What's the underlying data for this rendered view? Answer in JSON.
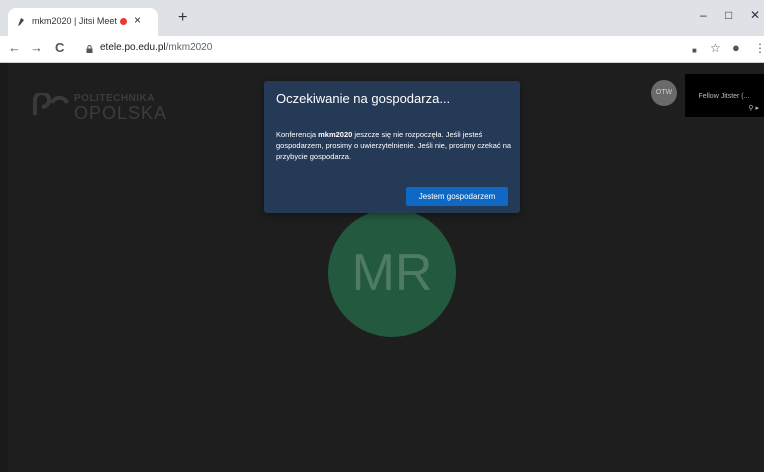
{
  "browser": {
    "tab_title": "mkm2020 | Jitsi Meet",
    "tab_close": "×",
    "new_tab": "+",
    "url_host": "etele.po.edu.pl",
    "url_path": "/mkm2020",
    "nav": {
      "back": "←",
      "forward": "→",
      "reload": "C"
    },
    "window": {
      "minimize": "–",
      "maximize": "□",
      "close": "✕"
    },
    "tools": {
      "camera": "■",
      "bookmark": "☆",
      "account": "●",
      "menu": "⋮"
    }
  },
  "logo": {
    "line1": "POLITECHNIKA",
    "line2": "OPOLSKA"
  },
  "avatar_large": "MR",
  "avatar_small": "OTW",
  "thumbnail": {
    "label": "Fellow Jitster (...",
    "icons": "⚲ ▸"
  },
  "dialog": {
    "title": "Oczekiwanie na gospodarza...",
    "body_prefix": "Konferencja ",
    "body_room": "mkm2020",
    "body_suffix": " jeszcze się nie rozpoczęła. Jeśli jesteś gospodarzem, prosimy o uwierzytelnienie. Jeśli nie, prosimy czekać na przybycie gospodarza.",
    "button": "Jestem gospodarzem"
  },
  "colors": {
    "dialog_bg": "#253a57",
    "button_bg": "#0e68c4",
    "avatar_bg": "#23593f"
  }
}
